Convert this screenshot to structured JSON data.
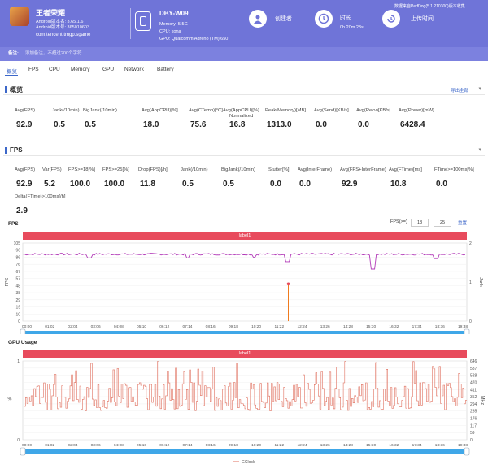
{
  "app": {
    "name": "王者荣耀",
    "android_name": "Android版本名: 3.65.1.6",
    "android_code": "Android版本号: 365010603",
    "package": "com.tencent.tmgp.sgame"
  },
  "device": {
    "model": "DBY-W09",
    "memory": "Memory: 5.5G",
    "cpu": "CPU: kona",
    "gpu": "GPU: Qualcomm Adreno (TM) 650"
  },
  "creator": {
    "label": "创建者"
  },
  "duration": {
    "label": "时长",
    "value": "0h 20m 23s"
  },
  "upload": {
    "label": "上传时间",
    "note": "数据来自PerfDog(5.1.210300)版本收集"
  },
  "note": {
    "label": "备注:",
    "placeholder": "添加备注，不超过200个字符"
  },
  "tabs": [
    "概览",
    "FPS",
    "CPU",
    "Memory",
    "GPU",
    "Network",
    "Battery"
  ],
  "overview": {
    "title": "概览",
    "export": "导出全部",
    "metrics": [
      {
        "label": "Avg(FPS)",
        "value": "92.9"
      },
      {
        "label": "Jank(/10min)",
        "value": "0.5"
      },
      {
        "label": "BigJank(/10min)",
        "value": "0.5"
      },
      {
        "label": "Avg(AppCPU)[%]",
        "value": "18.0"
      },
      {
        "label": "Avg(CTemp)[°C]",
        "value": "75.6"
      },
      {
        "label": "Avg(AppCPU)[%]",
        "label2": "Normalized",
        "value": "16.8"
      },
      {
        "label": "Peak(Memory)[MB]",
        "value": "1313.0"
      },
      {
        "label": "Avg(Send)[KB/s]",
        "value": "0.0"
      },
      {
        "label": "Avg(Recv)[KB/s]",
        "value": "0.0"
      },
      {
        "label": "Avg(Power)[mW]",
        "value": "6428.4"
      }
    ]
  },
  "fps_section": {
    "title": "FPS",
    "metrics": [
      {
        "label": "Avg(FPS)",
        "value": "92.9"
      },
      {
        "label": "Var(FPS)",
        "value": "5.2"
      },
      {
        "label": "FPS>=18[%]",
        "value": "100.0"
      },
      {
        "label": "FPS>=25[%]",
        "value": "100.0"
      },
      {
        "label": "Drop(FPS)[/h]",
        "value": "11.8"
      },
      {
        "label": "Jank(/10min)",
        "value": "0.5"
      },
      {
        "label": "BigJank(/10min)",
        "value": "0.5"
      },
      {
        "label": "Stutter[%]",
        "value": "0.0"
      },
      {
        "label": "Avg(InterFrame)",
        "value": "0.0"
      },
      {
        "label": "Avg(FPS+InterFrame)",
        "value": "92.9"
      },
      {
        "label": "Avg(FTime)[ms]",
        "value": "10.8"
      },
      {
        "label": "FTime>=100ms[%]",
        "value": "0.0"
      },
      {
        "label": "Delta(FTime)>100ms[/h]",
        "value": "2.9"
      }
    ],
    "threshold_label": "FPS(>=)",
    "threshold_1": "18",
    "threshold_2": "25",
    "reset": "重置"
  },
  "fps_chart": {
    "title": "FPS",
    "band": "label1",
    "ylabel_left": "FPS",
    "ylabel_right": "Jank",
    "yticks": [
      "105",
      "96",
      "86",
      "76",
      "67",
      "57",
      "48",
      "38",
      "29",
      "19",
      "10",
      "0"
    ],
    "yticks_right": [
      "2",
      "1",
      "0"
    ],
    "xticks": [
      "00:00",
      "01:02",
      "02:04",
      "03:06",
      "04:08",
      "05:10",
      "06:12",
      "07:14",
      "08:16",
      "09:18",
      "10:20",
      "11:22",
      "12:24",
      "13:26",
      "14:28",
      "15:30",
      "16:32",
      "17:34",
      "18:36",
      "19:38"
    ]
  },
  "gpu_chart": {
    "title": "GPU Usage",
    "band": "label1",
    "ylabel_left": "%",
    "ylabel_right": "MHz",
    "yticks": [
      "1",
      "",
      "",
      "",
      "",
      "0"
    ],
    "yticks_right": [
      "646",
      "587",
      "528",
      "470",
      "411",
      "352",
      "294",
      "235",
      "176",
      "117",
      "59",
      "0"
    ],
    "xticks": [
      "00:00",
      "01:02",
      "02:04",
      "03:06",
      "04:08",
      "05:10",
      "06:12",
      "07:14",
      "08:16",
      "09:18",
      "10:20",
      "11:22",
      "12:24",
      "13:26",
      "14:28",
      "15:30",
      "16:32",
      "17:34",
      "18:36",
      "19:38"
    ],
    "legend": "GClock"
  },
  "colors": {
    "header": "#6f74d8",
    "accent": "#3c67c9",
    "band": "#e84b5d",
    "fps_line": "#b23ab8",
    "gpu_line": "#e0705f",
    "scroll": "#3fa7e8"
  },
  "chart_data": [
    {
      "type": "line",
      "title": "FPS",
      "xlabel": "",
      "ylabel": "FPS",
      "ylim": [
        0,
        105
      ],
      "x_range": [
        "00:00",
        "20:23"
      ],
      "series": [
        {
          "name": "",
          "values_summary": "steady around 90 with dips to ~80 near 10:40, 12:18 and 16:24 (down to ~70)"
        }
      ],
      "jank_marker": {
        "time": "12:18",
        "value": 1
      }
    },
    {
      "type": "line",
      "title": "GPU Usage",
      "xlabel": "",
      "ylabel": "%",
      "ylim": [
        0,
        1
      ],
      "series": [
        {
          "name": "GClock",
          "unit": "MHz",
          "ylim": [
            0,
            646
          ],
          "values_summary": "oscillates between ~230 and ~646 MHz, frequent spikes throughout"
        }
      ]
    }
  ]
}
